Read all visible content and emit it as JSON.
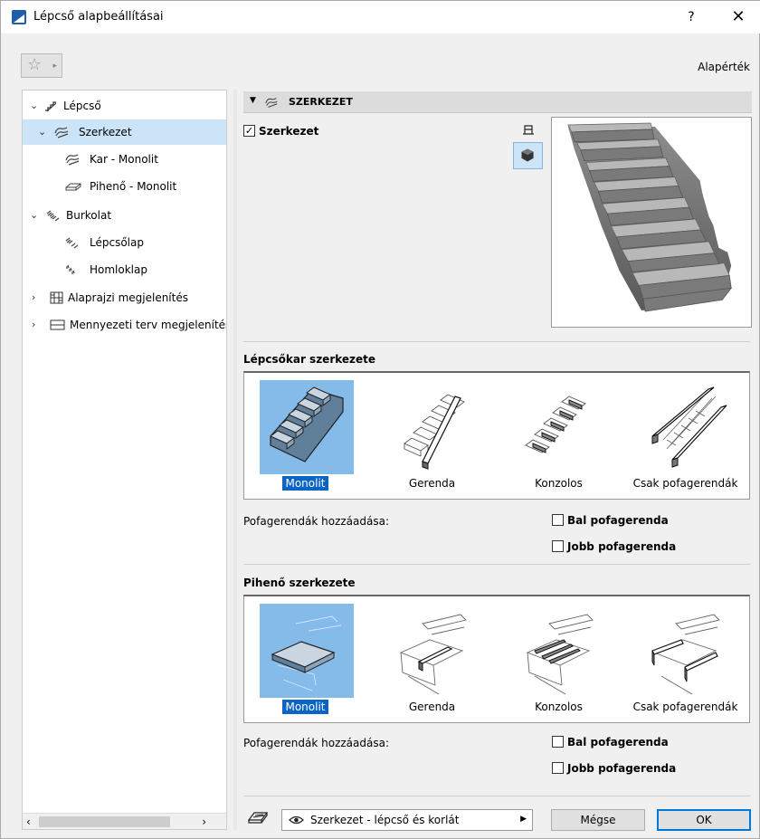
{
  "window": {
    "title": "Lépcső alapbeállításai",
    "help": "?",
    "close": "✕"
  },
  "toolbar": {
    "favorites_icon": "☆",
    "favorites_arrow": "▸",
    "default_label": "Alapérték"
  },
  "tree": {
    "items": [
      {
        "label": "Lépcső",
        "chevron": "⌄"
      },
      {
        "label": "Szerkezet",
        "chevron": "⌄"
      },
      {
        "label": "Kar - Monolit"
      },
      {
        "label": "Pihenő - Monolit"
      },
      {
        "label": "Burkolat",
        "chevron": "⌄"
      },
      {
        "label": "Lépcsőlap"
      },
      {
        "label": "Homloklap"
      },
      {
        "label": "Alaprajzi megjelenítés",
        "chevron": "›"
      },
      {
        "label": "Mennyezeti terv megjelenítés",
        "chevron": "›"
      }
    ],
    "scroll_left": "‹",
    "scroll_right": "›"
  },
  "section": {
    "title": "SZERKEZET",
    "toggle": "▼",
    "structure_checkbox_label": "Szerkezet",
    "structure_checked": "✓"
  },
  "flight": {
    "title": "Lépcsőkar szerkezete",
    "options": [
      "Monolit",
      "Gerenda",
      "Konzolos",
      "Csak pofagerendák"
    ],
    "selected": "Monolit",
    "stringers_label": "Pofagerendák hozzáadása:",
    "left_stringer": "Bal pofagerenda",
    "right_stringer": "Jobb pofagerenda"
  },
  "landing": {
    "title": "Pihenő szerkezete",
    "options": [
      "Monolit",
      "Gerenda",
      "Konzolos",
      "Csak pofagerendák"
    ],
    "selected": "Monolit",
    "stringers_label": "Pofagerendák hozzáadása:",
    "left_stringer": "Bal pofagerenda",
    "right_stringer": "Jobb pofagerenda"
  },
  "footer": {
    "layer_combo": "Szerkezet - lépcső és korlát",
    "combo_arrow": "▶",
    "cancel": "Mégse",
    "ok": "OK"
  },
  "colors": {
    "selection": "#cce4f7",
    "option_selected_bg": "#84bbe9",
    "caption_selected": "#0a64c8"
  }
}
